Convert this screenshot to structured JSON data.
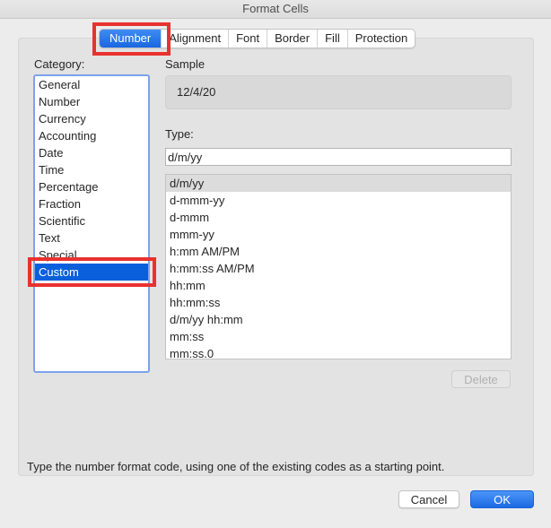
{
  "window": {
    "title": "Format Cells"
  },
  "tabs": [
    {
      "label": "Number",
      "active": true
    },
    {
      "label": "Alignment",
      "active": false
    },
    {
      "label": "Font",
      "active": false
    },
    {
      "label": "Border",
      "active": false
    },
    {
      "label": "Fill",
      "active": false
    },
    {
      "label": "Protection",
      "active": false
    }
  ],
  "category": {
    "label": "Category:",
    "items": [
      "General",
      "Number",
      "Currency",
      "Accounting",
      "Date",
      "Time",
      "Percentage",
      "Fraction",
      "Scientific",
      "Text",
      "Special",
      "Custom"
    ],
    "selected": "Custom"
  },
  "sample": {
    "label": "Sample",
    "value": "12/4/20"
  },
  "type": {
    "label": "Type:",
    "value": "d/m/yy",
    "codes": [
      "d/m/yy",
      "d-mmm-yy",
      "d-mmm",
      "mmm-yy",
      "h:mm AM/PM",
      "h:mm:ss AM/PM",
      "hh:mm",
      "hh:mm:ss",
      "d/m/yy hh:mm",
      "mm:ss",
      "mm:ss.0"
    ],
    "highlighted": "d/m/yy"
  },
  "buttons": {
    "delete": "Delete",
    "cancel": "Cancel",
    "ok": "OK"
  },
  "hint": "Type the number format code, using one of the existing codes as a starting point.",
  "colors": {
    "accent": "#0a5fdc",
    "annotation": "#e8322f"
  }
}
